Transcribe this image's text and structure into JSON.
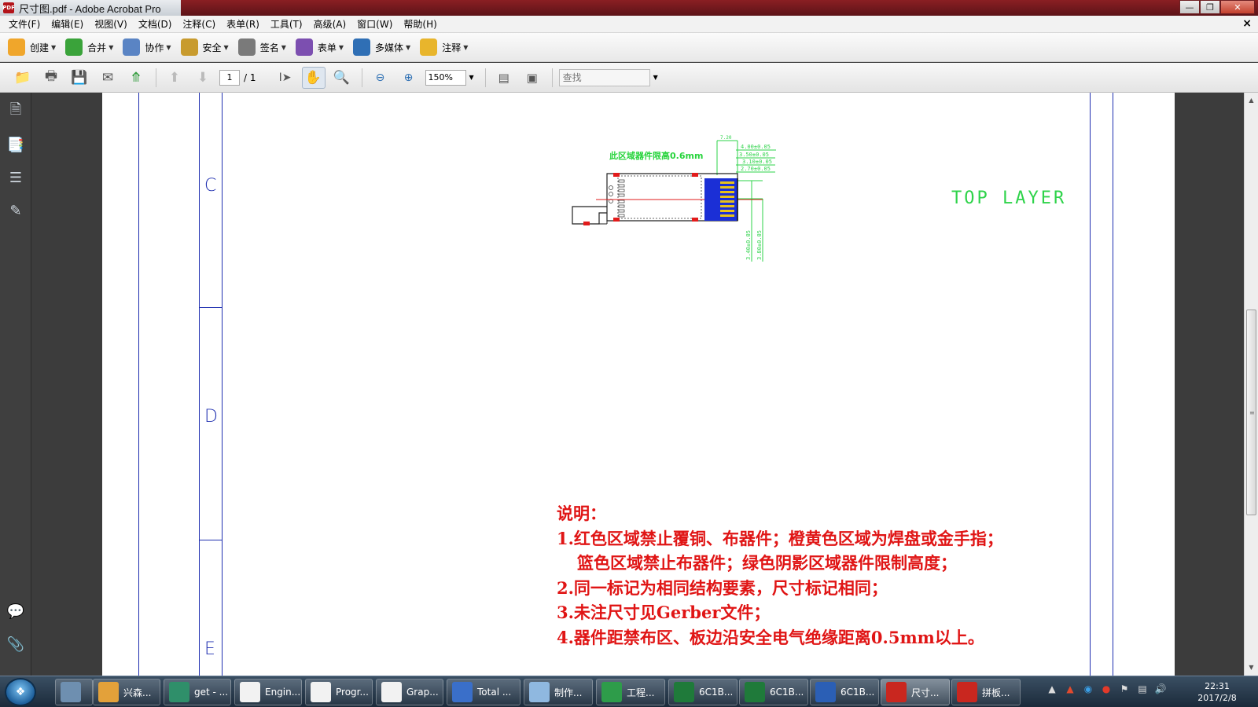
{
  "window": {
    "title": "尺寸图.pdf - Adobe Acrobat Pro",
    "title_icon": "pdf-icon"
  },
  "menu": [
    {
      "label": "文件(F)"
    },
    {
      "label": "编辑(E)"
    },
    {
      "label": "视图(V)"
    },
    {
      "label": "文档(D)"
    },
    {
      "label": "注释(C)"
    },
    {
      "label": "表单(R)"
    },
    {
      "label": "工具(T)"
    },
    {
      "label": "高级(A)"
    },
    {
      "label": "窗口(W)"
    },
    {
      "label": "帮助(H)"
    }
  ],
  "tasks": [
    {
      "label": "创建",
      "icon": "create-icon",
      "color": "#f0a62b"
    },
    {
      "label": "合并",
      "icon": "combine-icon",
      "color": "#3aa33a"
    },
    {
      "label": "协作",
      "icon": "collaborate-icon",
      "color": "#5a84c4"
    },
    {
      "label": "安全",
      "icon": "lock-icon",
      "color": "#c89b2e"
    },
    {
      "label": "签名",
      "icon": "pen-icon",
      "color": "#7a7a7a"
    },
    {
      "label": "表单",
      "icon": "form-icon",
      "color": "#7c4fb0"
    },
    {
      "label": "多媒体",
      "icon": "multimedia-icon",
      "color": "#2f6fb5"
    },
    {
      "label": "注释",
      "icon": "comment-icon",
      "color": "#e8b52c"
    }
  ],
  "toolbar": {
    "page_current": "1",
    "page_total": "/ 1",
    "zoom": "150%",
    "find_placeholder": "查找"
  },
  "document": {
    "zone_letters": [
      "C",
      "D",
      "E"
    ],
    "layer_label": "TOP LAYER",
    "drawing": {
      "keepout_label": "此区域器件限高0.6mm",
      "dim_top": "7.20",
      "dims_right": [
        "4.00±0.05",
        "3.50±0.05",
        "3.10±0.05",
        "2.70±0.05"
      ],
      "dims_bottom": [
        "3.40±0.05",
        "3.80±0.05"
      ]
    },
    "notes": [
      "说明：",
      "1.红色区域禁止覆铜、布器件；橙黄色区域为焊盘或金手指；",
      "篮色区域禁止布器件；绿色阴影区域器件限制高度；",
      "2.同一标记为相同结构要素，尺寸标记相同；",
      "3.未注尺寸见Gerber文件；",
      "4.器件距禁布区、板边沿安全电气绝缘距离0.5mm以上。"
    ]
  },
  "taskbar": {
    "items": [
      {
        "label": "",
        "icon": "calculator-icon",
        "color": "#6e8fb0"
      },
      {
        "label": "兴森...",
        "icon": "shell-icon",
        "color": "#e3a13a"
      },
      {
        "label": "get - ...",
        "icon": "browser-icon",
        "color": "#2f8f6a"
      },
      {
        "label": "Engin...",
        "icon": "app-x-icon",
        "color": "#f2f2f2"
      },
      {
        "label": "Progr...",
        "icon": "app-x-icon",
        "color": "#f2f2f2"
      },
      {
        "label": "Grap...",
        "icon": "app-x-icon",
        "color": "#f2f2f2"
      },
      {
        "label": "Total ...",
        "icon": "floppy-icon",
        "color": "#3a6fc9"
      },
      {
        "label": "制作...",
        "icon": "notepad-icon",
        "color": "#8fb8e0"
      },
      {
        "label": "工程...",
        "icon": "pads-icon",
        "color": "#2e9c4a"
      },
      {
        "label": "6C1B...",
        "icon": "excel-icon",
        "color": "#1f7a3a"
      },
      {
        "label": "6C1B...",
        "icon": "excel-icon",
        "color": "#1f7a3a"
      },
      {
        "label": "6C1B...",
        "icon": "word-icon",
        "color": "#2b5fb5"
      },
      {
        "label": "尺寸...",
        "icon": "pdf-icon",
        "color": "#c9271f"
      },
      {
        "label": "拼板...",
        "icon": "pdf-icon",
        "color": "#c9271f"
      }
    ],
    "clock_time": "22:31",
    "clock_date": "2017/2/8"
  }
}
